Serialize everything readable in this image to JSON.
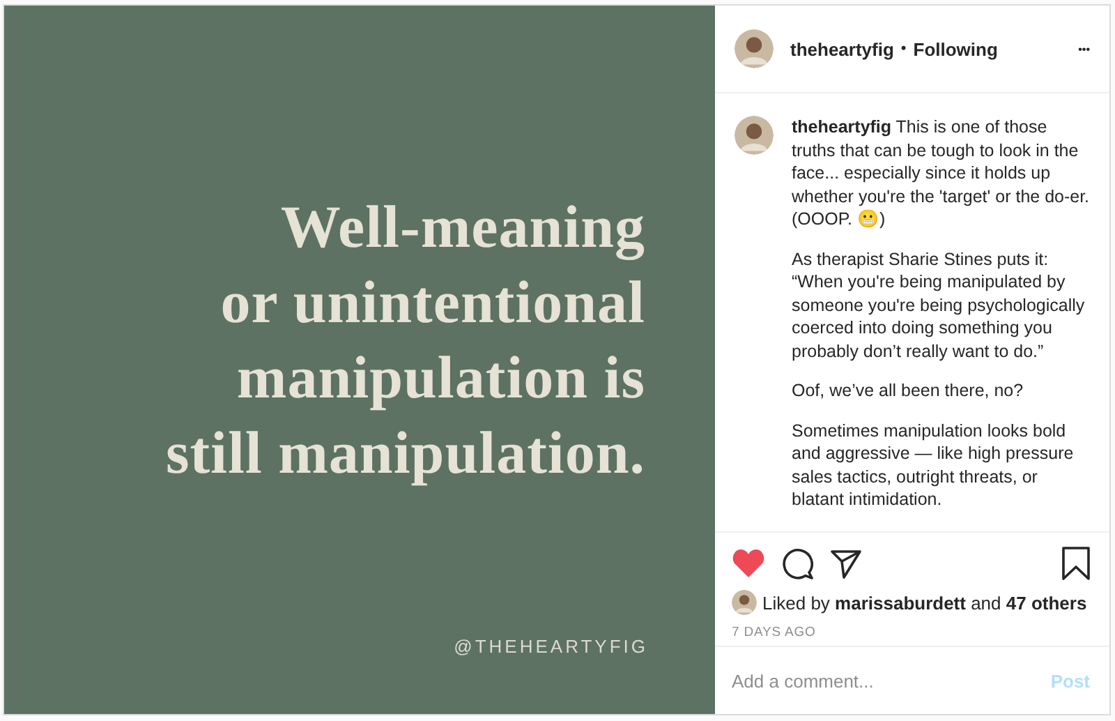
{
  "post_image": {
    "lines": [
      "Well-meaning",
      "or unintentional",
      "manipulation is",
      "still manipulation."
    ],
    "handle": "@THEHEARTYFIG"
  },
  "header": {
    "username": "theheartyfig",
    "separator": "•",
    "follow_label": "Following",
    "more": "•••"
  },
  "caption": [
    "**theheartyfig** This is one of those truths that can be tough to look in the face... especially since it holds up whether you're the 'target' or the do-er. (OOOP. 😬)",
    "As therapist Sharie Stines puts it: “When you're being manipulated by someone you're being psychologically coerced into doing something you probably don’t really want to do.”",
    "Oof, we’ve all been there, no?",
    "Sometimes manipulation looks bold and aggressive — like high pressure sales tactics, outright threats, or blatant intimidation."
  ],
  "actions": {
    "liked": true,
    "saved": false
  },
  "likes": "Liked by **marissaburdett** and **47 others**",
  "timestamp": "7 DAYS AGO",
  "comment": {
    "placeholder": "Add a comment...",
    "post_label": "Post",
    "disabled": true
  }
}
